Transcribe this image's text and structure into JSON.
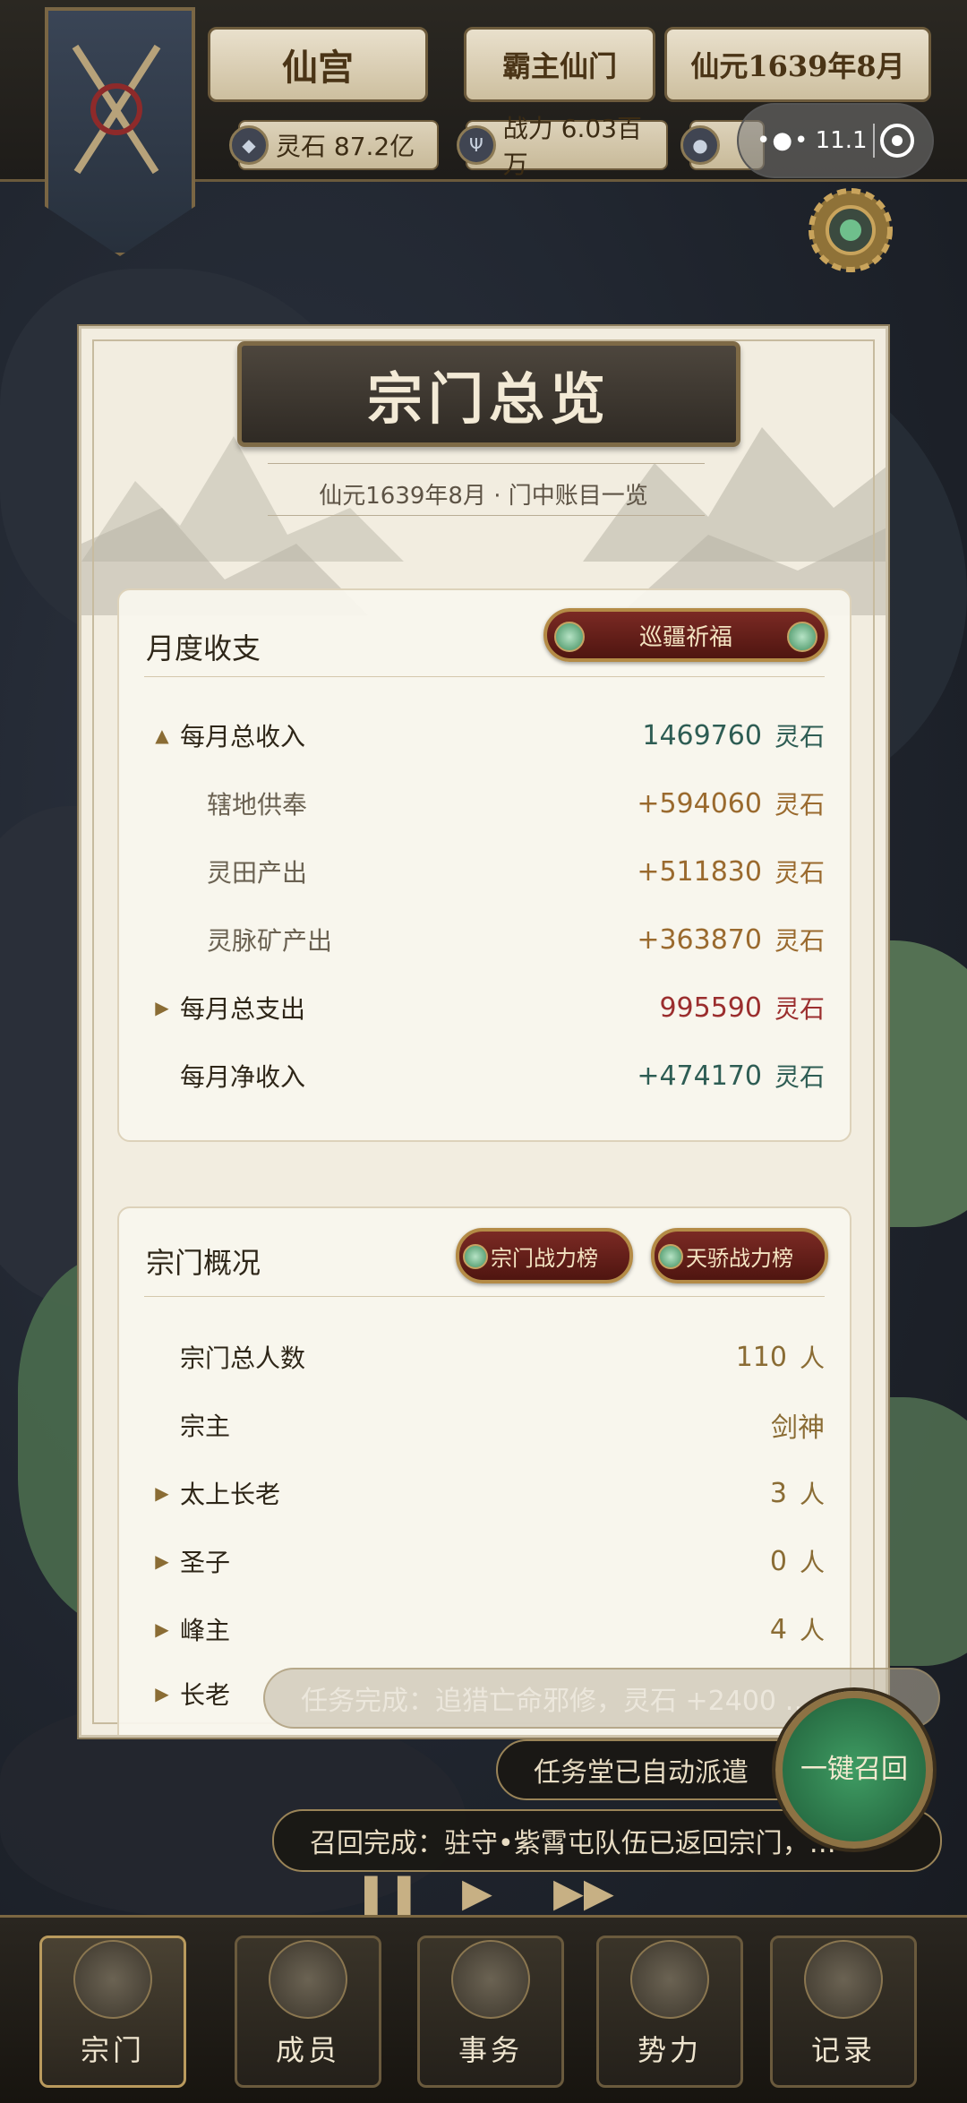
{
  "header": {
    "realm": "仙宫",
    "sect_title": "霸主仙门",
    "date": "仙元1639年8月",
    "spirit_stones": "灵石 87.2亿",
    "power": "战力 6.03百万",
    "capsule_text": "11.1"
  },
  "panel": {
    "title": "宗门总览",
    "subtitle": "仙元1639年8月 · 门中账目一览",
    "finance": {
      "heading": "月度收支",
      "button": "巡疆祈福",
      "rows": [
        {
          "label": "每月总收入",
          "value": "1469760",
          "unit": "灵石"
        },
        {
          "label": "辖地供奉",
          "value": "+594060",
          "unit": "灵石"
        },
        {
          "label": "灵田产出",
          "value": "+511830",
          "unit": "灵石"
        },
        {
          "label": "灵脉矿产出",
          "value": "+363870",
          "unit": "灵石"
        },
        {
          "label": "每月总支出",
          "value": "995590",
          "unit": "灵石"
        },
        {
          "label": "每月净收入",
          "value": "+474170",
          "unit": "灵石"
        }
      ]
    },
    "overview": {
      "heading": "宗门概况",
      "button_power": "宗门战力榜",
      "button_prodigy": "天骄战力榜",
      "rows": [
        {
          "label": "宗门总人数",
          "value": "110",
          "unit": "人"
        },
        {
          "label": "宗主",
          "value": "剑神",
          "unit": ""
        },
        {
          "label": "太上长老",
          "value": "3",
          "unit": "人"
        },
        {
          "label": "圣子",
          "value": "0",
          "unit": "人"
        },
        {
          "label": "峰主",
          "value": "4",
          "unit": "人"
        },
        {
          "label": "长老",
          "value": "",
          "unit": ""
        }
      ]
    }
  },
  "toasts": {
    "mission_done": "任务完成：追猎亡命邪修，灵石 +2400 …",
    "hall_dispatch": "任务堂已自动派遣",
    "recall_done": "召回完成：驻守•紫霄屯队伍已返回宗门，…"
  },
  "recall_button": "一键召回",
  "nav": [
    "宗门",
    "成员",
    "事务",
    "势力",
    "记录"
  ],
  "colors": {
    "income": "#2e5d54",
    "gain": "#9a6a2e",
    "expense": "#9b2e2e",
    "accent": "#b48b46"
  }
}
